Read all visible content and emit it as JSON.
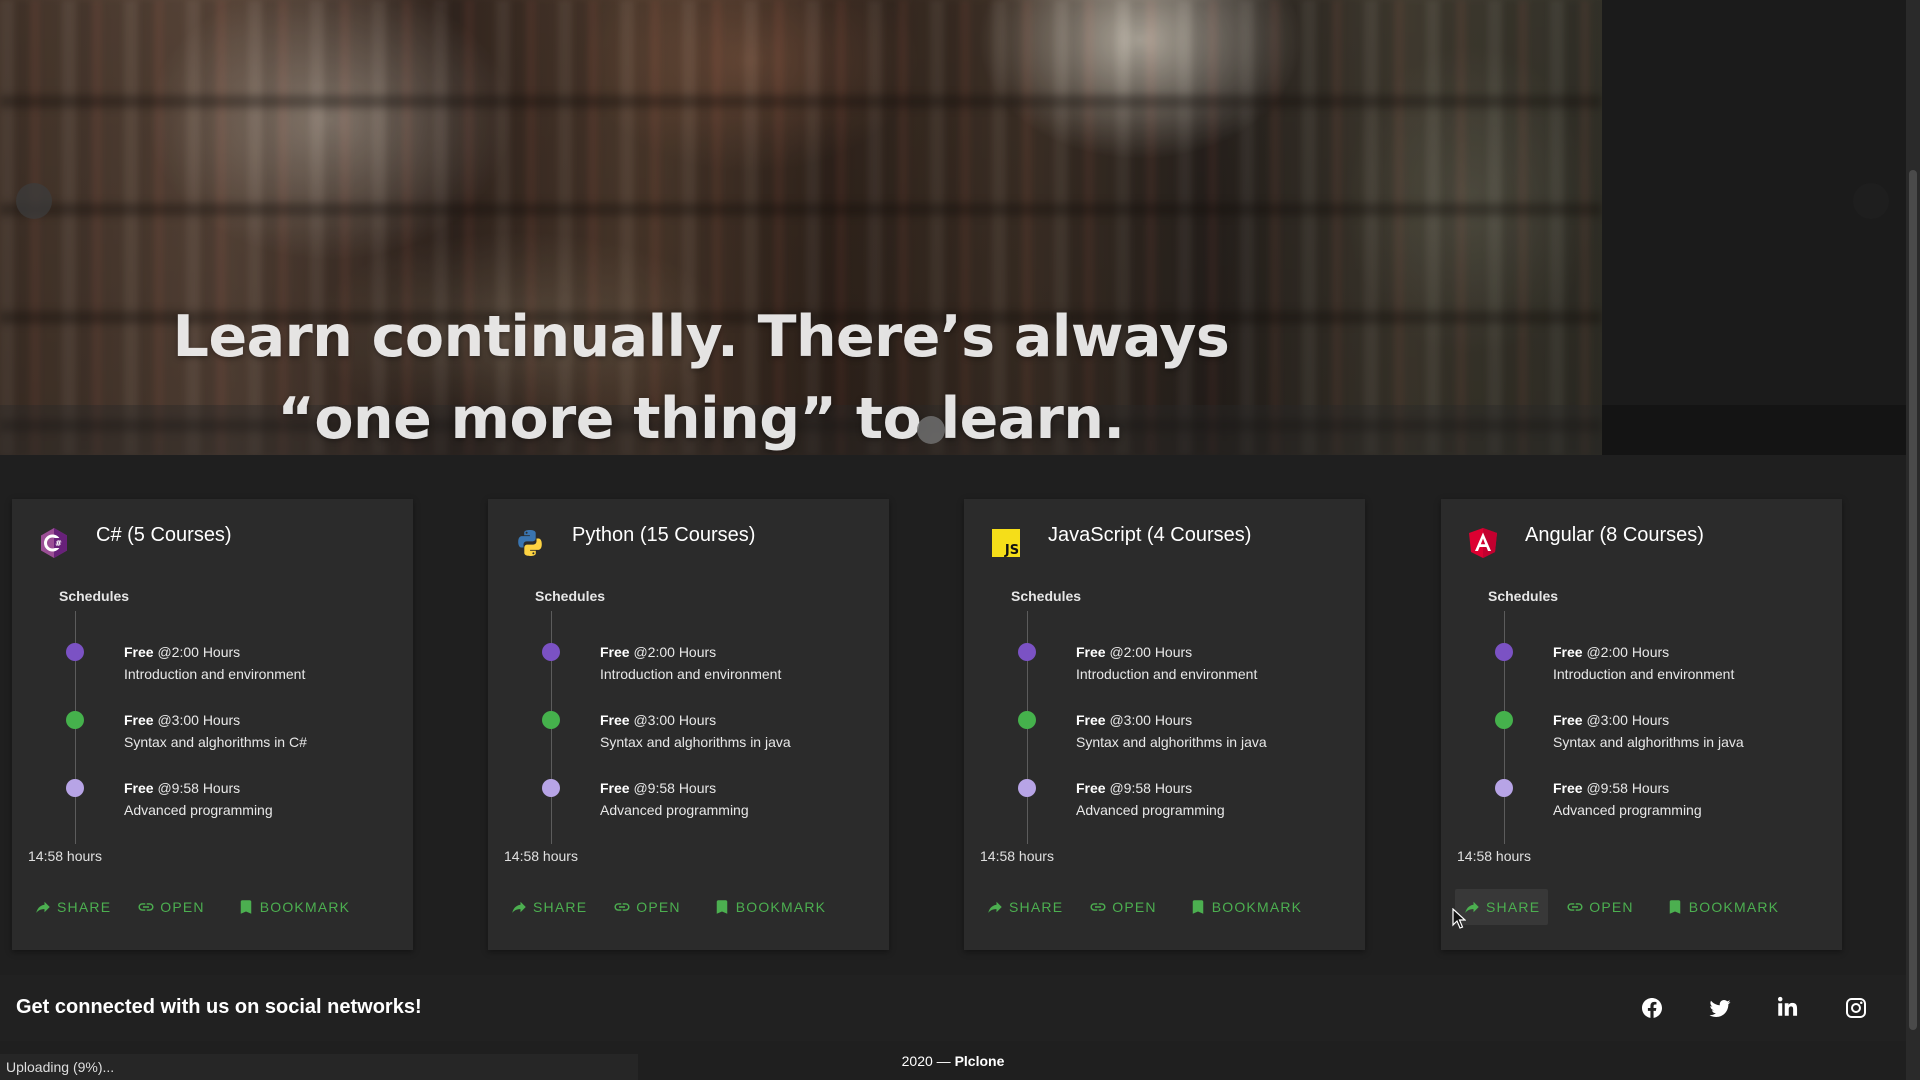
{
  "hero": {
    "quote_line1": "Learn continually. There’s always",
    "quote_line2": "“one more thing” to learn."
  },
  "colors": {
    "accent_green": "#4caf50",
    "dot_purple": "#7b52c4",
    "dot_green": "#45b14c",
    "dot_lilac": "#b7a4e6",
    "card_bg": "#2b2b2b",
    "page_bg": "#1f1f1f"
  },
  "courses": [
    {
      "icon": "csharp-icon",
      "title": "C# (5 Courses)",
      "schedules_label": "Schedules",
      "schedule": [
        {
          "price": "Free",
          "time": "@2:00 Hours",
          "topic": "Introduction and environment"
        },
        {
          "price": "Free",
          "time": "@3:00 Hours",
          "topic": "Syntax and alghorithms in C#"
        },
        {
          "price": "Free",
          "time": "@9:58 Hours",
          "topic": "Advanced programming"
        }
      ],
      "total": "14:58 hours",
      "actions": {
        "share": "SHARE",
        "open": "OPEN",
        "bookmark": "BOOKMARK"
      }
    },
    {
      "icon": "python-icon",
      "title": "Python (15 Courses)",
      "schedules_label": "Schedules",
      "schedule": [
        {
          "price": "Free",
          "time": "@2:00 Hours",
          "topic": "Introduction and environment"
        },
        {
          "price": "Free",
          "time": "@3:00 Hours",
          "topic": "Syntax and alghorithms in java"
        },
        {
          "price": "Free",
          "time": "@9:58 Hours",
          "topic": "Advanced programming"
        }
      ],
      "total": "14:58 hours",
      "actions": {
        "share": "SHARE",
        "open": "OPEN",
        "bookmark": "BOOKMARK"
      }
    },
    {
      "icon": "javascript-icon",
      "title": "JavaScript (4 Courses)",
      "schedules_label": "Schedules",
      "schedule": [
        {
          "price": "Free",
          "time": "@2:00 Hours",
          "topic": "Introduction and environment"
        },
        {
          "price": "Free",
          "time": "@3:00 Hours",
          "topic": "Syntax and alghorithms in java"
        },
        {
          "price": "Free",
          "time": "@9:58 Hours",
          "topic": "Advanced programming"
        }
      ],
      "total": "14:58 hours",
      "actions": {
        "share": "SHARE",
        "open": "OPEN",
        "bookmark": "BOOKMARK"
      }
    },
    {
      "icon": "angular-icon",
      "title": "Angular (8 Courses)",
      "schedules_label": "Schedules",
      "schedule": [
        {
          "price": "Free",
          "time": "@2:00 Hours",
          "topic": "Introduction and environment"
        },
        {
          "price": "Free",
          "time": "@3:00 Hours",
          "topic": "Syntax and alghorithms in java"
        },
        {
          "price": "Free",
          "time": "@9:58 Hours",
          "topic": "Advanced programming"
        }
      ],
      "total": "14:58 hours",
      "actions": {
        "share": "SHARE",
        "open": "OPEN",
        "bookmark": "BOOKMARK"
      }
    }
  ],
  "footer": {
    "social_heading": "Get connected with us on social networks!",
    "social_icons": [
      "facebook-icon",
      "twitter-icon",
      "linkedin-icon",
      "instagram-icon"
    ],
    "copyright_prefix": "2020 —",
    "copyright_brand": "Plclone"
  },
  "status": {
    "upload_text": "Uploading (9%)...",
    "upload_progress_percent": 9
  }
}
